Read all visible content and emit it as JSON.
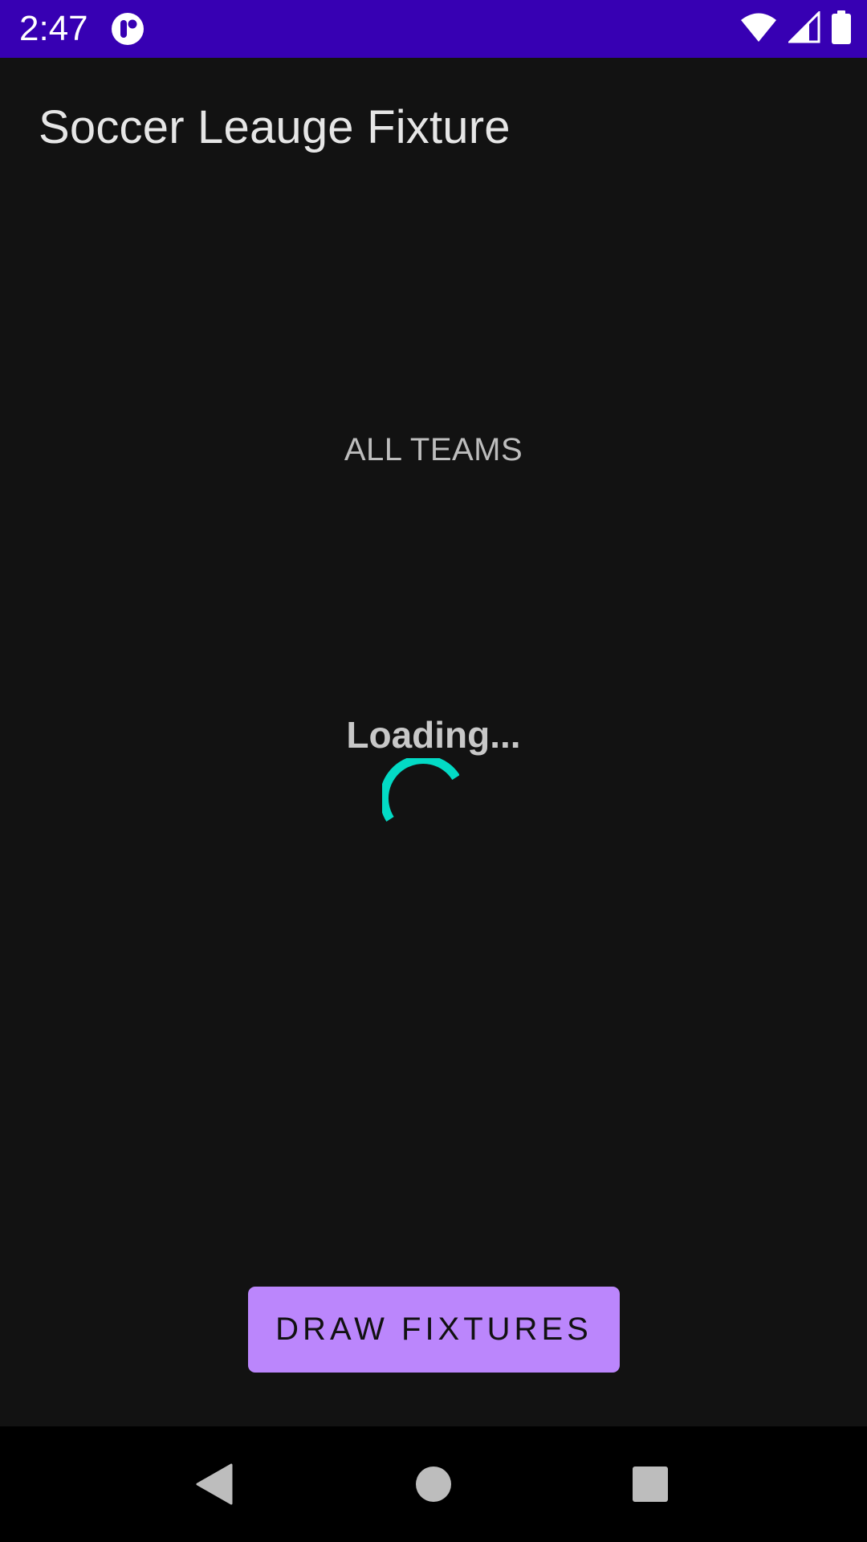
{
  "status_bar": {
    "time": "2:47",
    "background_color": "#3700b3",
    "app_icon": "app-notification-icon",
    "icons": [
      "wifi-icon",
      "cellular-signal-icon",
      "battery-icon"
    ]
  },
  "app_bar": {
    "title": "Soccer Leauge Fixture"
  },
  "main": {
    "section_header": "ALL TEAMS",
    "loading_text": "Loading...",
    "spinner_color": "#03dac5"
  },
  "actions": {
    "draw_button_label": "DRAW FIXTURES",
    "draw_button_color": "#bb86fc"
  },
  "nav_bar": {
    "buttons": [
      "back-icon",
      "home-icon",
      "recents-icon"
    ]
  }
}
